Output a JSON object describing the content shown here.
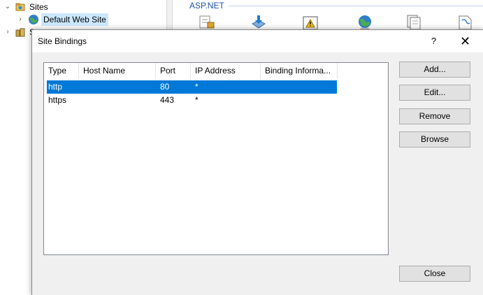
{
  "background": {
    "tree": {
      "items": [
        {
          "label": "Sites",
          "icon": "sites-folder-icon"
        },
        {
          "label": "Default Web Site",
          "icon": "globe-icon"
        },
        {
          "label": "S",
          "icon": "app-pools-icon"
        }
      ]
    },
    "features": {
      "group_title": "ASP.NET",
      "icons": [
        "authorization-icon",
        "download-icon",
        "warning-icon",
        "globe-icon",
        "pages-icon",
        "document-icon"
      ]
    }
  },
  "dialog": {
    "title": "Site Bindings",
    "help_glyph": "?",
    "close_glyph": "✕",
    "columns": [
      "Type",
      "Host Name",
      "Port",
      "IP Address",
      "Binding Informa..."
    ],
    "rows": [
      {
        "type": "http",
        "host": "",
        "port": "80",
        "ip": "*",
        "info": "",
        "selected": true
      },
      {
        "type": "https",
        "host": "",
        "port": "443",
        "ip": "*",
        "info": "",
        "selected": false
      }
    ],
    "buttons": {
      "add": "Add...",
      "edit": "Edit...",
      "remove": "Remove",
      "browse": "Browse",
      "close": "Close"
    }
  },
  "colors": {
    "selection": "#0078d7",
    "tree_selection": "#cce8ff",
    "group_title": "#1e50a0"
  }
}
